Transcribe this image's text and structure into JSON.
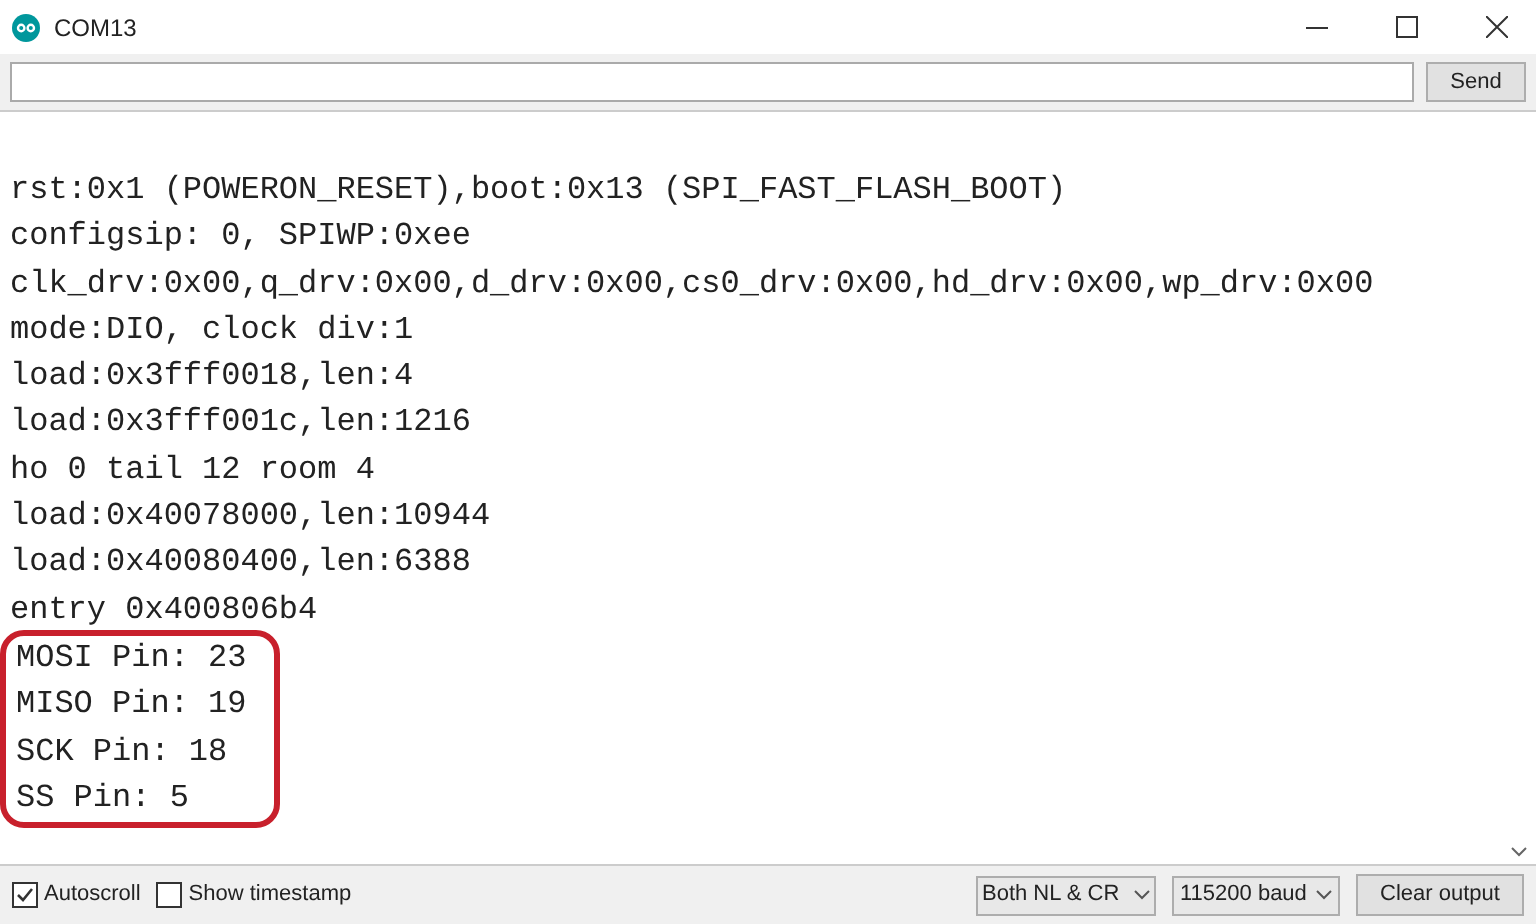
{
  "window": {
    "title": "COM13"
  },
  "send_button": "Send",
  "output": {
    "lines": [
      {
        "text": "rst:0x1 (POWERON_RESET),boot:0x13 (SPI_FAST_FLASH_BOOT)",
        "highlighted": false
      },
      {
        "text": "configsip: 0, SPIWP:0xee",
        "highlighted": false
      },
      {
        "text": "clk_drv:0x00,q_drv:0x00,d_drv:0x00,cs0_drv:0x00,hd_drv:0x00,wp_drv:0x00",
        "highlighted": false
      },
      {
        "text": "mode:DIO, clock div:1",
        "highlighted": false
      },
      {
        "text": "load:0x3fff0018,len:4",
        "highlighted": false
      },
      {
        "text": "load:0x3fff001c,len:1216",
        "highlighted": false
      },
      {
        "text": "ho 0 tail 12 room 4",
        "highlighted": false
      },
      {
        "text": "load:0x40078000,len:10944",
        "highlighted": false
      },
      {
        "text": "load:0x40080400,len:6388",
        "highlighted": false
      },
      {
        "text": "entry 0x400806b4",
        "highlighted": false
      },
      {
        "text": "MOSI Pin: 23",
        "highlighted": true
      },
      {
        "text": "MISO Pin: 19",
        "highlighted": true
      },
      {
        "text": "SCK Pin: 18",
        "highlighted": true
      },
      {
        "text": "SS Pin: 5",
        "highlighted": true
      }
    ]
  },
  "footer": {
    "checkboxes": [
      {
        "label": "Autoscroll",
        "checked": true
      },
      {
        "label": "Show timestamp",
        "checked": false
      }
    ],
    "line_ending": "Both NL & CR",
    "baud": "115200 baud",
    "clear_button": "Clear output"
  }
}
